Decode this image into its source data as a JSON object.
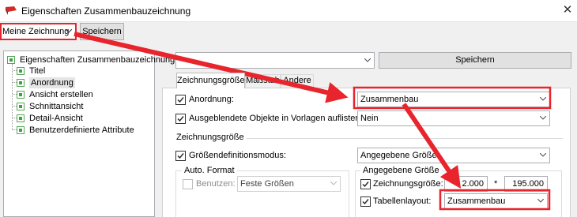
{
  "window": {
    "title": "Eigenschaften Zusammenbauzeichnung"
  },
  "toolbar": {
    "preset_value": "Meine Zeichnung",
    "save_label": "Speichern"
  },
  "tree": {
    "root": "Eigenschaften Zusammenbauzeichnung",
    "items": [
      "Titel",
      "Anordnung",
      "Ansicht erstellen",
      "Schnittansicht",
      "Detail-Ansicht",
      "Benutzerdefinierte Attribute"
    ]
  },
  "top": {
    "preset_value": "",
    "save_label": "Speichern"
  },
  "tabs": [
    "Zeichnungsgröße",
    "Maßstab",
    "Andere"
  ],
  "form": {
    "anordnung": {
      "label": "Anordnung:",
      "value": "Zusammenbau"
    },
    "hidden": {
      "label": "Ausgeblendete Objekte in Vorlagen auflisten",
      "value": "Nein"
    },
    "section_title": "Zeichnungsgröße",
    "size_mode": {
      "label": "Größendefinitionsmodus:",
      "value": "Angegebene Größe"
    },
    "auto_format": {
      "title": "Auto. Format",
      "use_label": "Benutzen:",
      "use_value": "Feste Größen"
    },
    "given_size": {
      "title": "Angegebene Größe",
      "size_label": "Zeichnungsgröße:",
      "width": "2.000",
      "times": "*",
      "height": "195.000",
      "table_label": "Tabellenlayout:",
      "table_value": "Zusammenbau"
    }
  },
  "colors": {
    "highlight": "#e8242c",
    "check": "#2e7d32",
    "tree_icon": "#3aa53a"
  }
}
